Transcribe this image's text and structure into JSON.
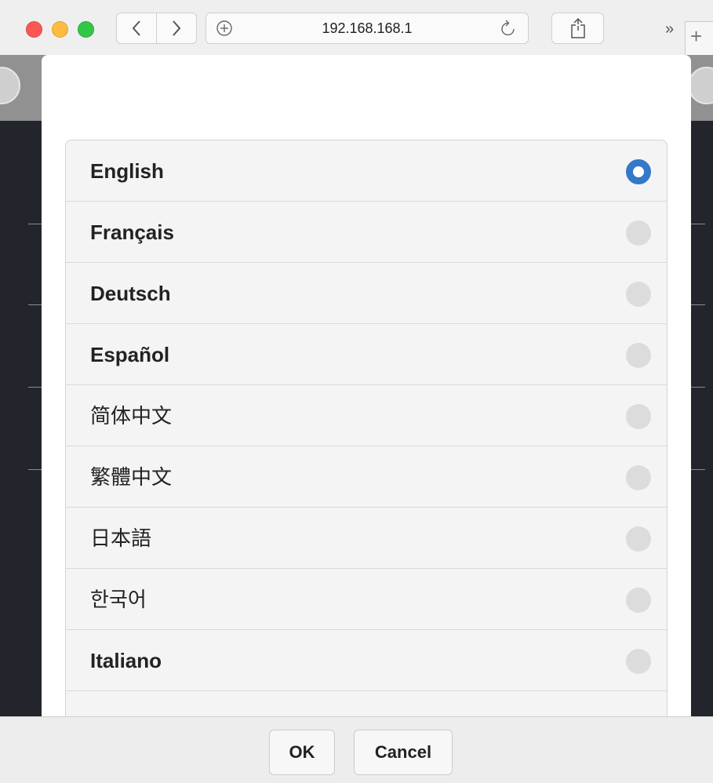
{
  "browser": {
    "url": "192.168.168.1",
    "overflow_label": "»",
    "new_tab_label": "+"
  },
  "dialog": {
    "languages": [
      {
        "label": "English",
        "selected": true
      },
      {
        "label": "Français",
        "selected": false
      },
      {
        "label": "Deutsch",
        "selected": false
      },
      {
        "label": "Español",
        "selected": false
      },
      {
        "label": "简体中文",
        "selected": false
      },
      {
        "label": "繁體中文",
        "selected": false
      },
      {
        "label": "日本語",
        "selected": false
      },
      {
        "label": "한국어",
        "selected": false
      },
      {
        "label": "Italiano",
        "selected": false
      },
      {
        "label": "",
        "selected": false
      }
    ],
    "ok_label": "OK",
    "cancel_label": "Cancel"
  },
  "colors": {
    "radio_selected": "#3478c8",
    "close_red": "#fc5753",
    "minimize_yellow": "#fdbc40",
    "zoom_green": "#33c748"
  }
}
